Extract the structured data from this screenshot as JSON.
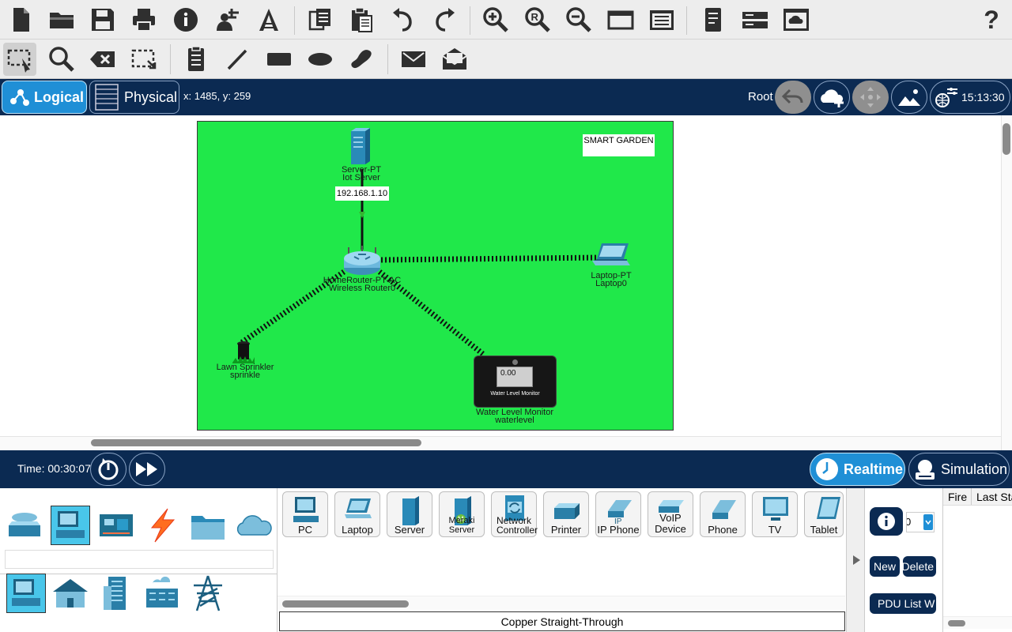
{
  "toolbar_top": {
    "items": [
      "new-icon",
      "open-icon",
      "save-icon",
      "print-icon",
      "info-icon",
      "activity-wizard-icon",
      "network-info-icon",
      "copy-icon",
      "paste-icon",
      "undo-icon",
      "redo-icon",
      "zoom-in-icon",
      "zoom-reset-icon",
      "zoom-out-icon",
      "window-icon",
      "palette-icon",
      "custom-device-icon",
      "server-stack-icon",
      "cloud-view-icon",
      "help-icon"
    ],
    "help_label": "?"
  },
  "toolbar_second": {
    "items": [
      "select-icon",
      "inspect-icon",
      "delete-icon",
      "resize-icon",
      "note-icon",
      "line-icon",
      "rectangle-icon",
      "ellipse-icon",
      "freeform-icon",
      "add-simple-pdu-icon",
      "add-complex-pdu-icon"
    ]
  },
  "nav_bar": {
    "logical_label": "Logical",
    "physical_label": "Physical",
    "coords": "x: 1485, y: 259",
    "root_label": "Root",
    "clock": "15:13:30"
  },
  "canvas": {
    "background": "#20e84a",
    "note_text": "SMART GARDEN",
    "ip_label": "192.168.1.10",
    "devices": [
      {
        "type": "Server-PT",
        "name": "Iot Server"
      },
      {
        "type": "HomeRouter-PT-AC",
        "name": "Wireless Router0"
      },
      {
        "type": "Laptop-PT",
        "name": "Laptop0"
      },
      {
        "type": "Lawn Sprinkler",
        "name": "sprinkle"
      },
      {
        "type": "Water Level Monitor",
        "name": "waterlevel"
      }
    ],
    "monitor_value": "0.00",
    "monitor_caption": "Water Level Monitor"
  },
  "time_bar": {
    "time": "Time: 00:30:07",
    "realtime_label": "Realtime",
    "simulation_label": "Simulation"
  },
  "device_panel": {
    "devices": [
      "PC",
      "Laptop",
      "Server",
      "Meraki Server",
      "Network Controller",
      "Printer",
      "IP Phone",
      "VoIP Device",
      "Phone",
      "TV",
      "Tablet"
    ],
    "connection_label": "Copper Straight-Through"
  },
  "pdu_panel": {
    "new_label": "New",
    "delete_label": "Delete",
    "pdu_list_label": "PDU List W",
    "scenario_value": "0",
    "col_fire": "Fire",
    "col_last_status": "Last Sta"
  }
}
